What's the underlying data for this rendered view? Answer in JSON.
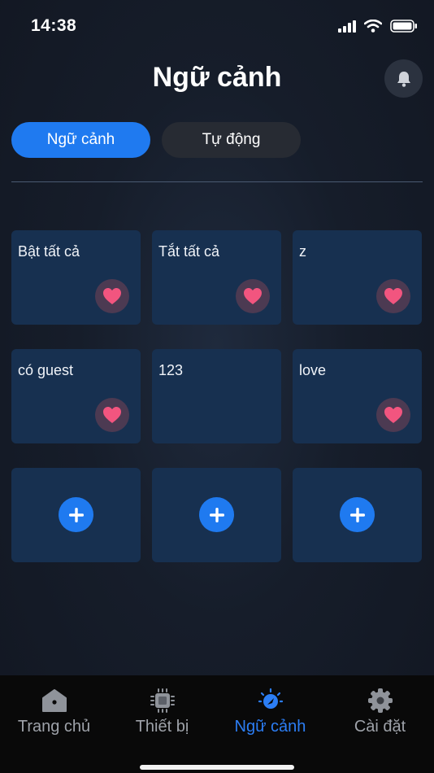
{
  "status_bar": {
    "time": "14:38"
  },
  "header": {
    "title": "Ngữ cảnh"
  },
  "tabs": [
    {
      "label": "Ngữ cảnh",
      "active": true
    },
    {
      "label": "Tự động",
      "active": false
    }
  ],
  "scenes": [
    {
      "label": "Bật tất cả",
      "favorite": true
    },
    {
      "label": "Tắt tất cả",
      "favorite": true
    },
    {
      "label": "z",
      "favorite": true
    },
    {
      "label": "có guest",
      "favorite": true
    },
    {
      "label": "123",
      "favorite": false
    },
    {
      "label": "love",
      "favorite": true
    }
  ],
  "bottom_nav": [
    {
      "label": "Trang chủ",
      "icon": "home-icon",
      "active": false
    },
    {
      "label": "Thiết bị",
      "icon": "chip-icon",
      "active": false
    },
    {
      "label": "Ngữ cảnh",
      "icon": "scene-icon",
      "active": true
    },
    {
      "label": "Cài đặt",
      "icon": "gear-icon",
      "active": false
    }
  ],
  "colors": {
    "accent": "#1f7af0",
    "card": "#173050",
    "heart": "#f2557f"
  }
}
